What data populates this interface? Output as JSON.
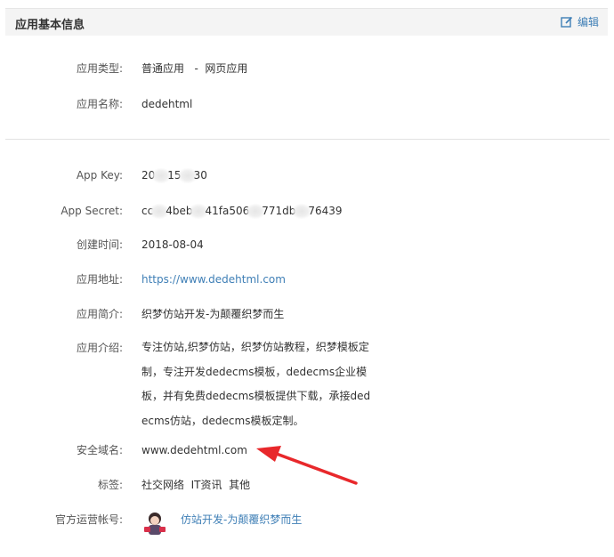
{
  "header": {
    "title": "应用基本信息",
    "edit_label": "编辑"
  },
  "fields": {
    "type": {
      "label": "应用类型:",
      "value": "普通应用   -  网页应用"
    },
    "name": {
      "label": "应用名称:",
      "value": "dedehtml"
    },
    "app_key": {
      "label": "App Key:",
      "parts": [
        "20",
        "15",
        "30"
      ]
    },
    "app_secret": {
      "label": "App Secret:",
      "parts": [
        "cc",
        "4beb",
        "41fa506",
        "771db",
        "76439"
      ]
    },
    "created": {
      "label": "创建时间:",
      "value": "2018-08-04"
    },
    "address": {
      "label": "应用地址:",
      "value": "https://www.dedehtml.com"
    },
    "brief": {
      "label": "应用简介:",
      "value": "织梦仿站开发-为颠覆织梦而生"
    },
    "intro": {
      "label": "应用介绍:",
      "value": "专注仿站,织梦仿站，织梦仿站教程，织梦模板定制，专注开发dedecms模板，dedecms企业模板，并有免费dedecms模板提供下载，承接dedecms仿站，dedecms模板定制。"
    },
    "domain": {
      "label": "安全域名:",
      "value": "www.dedehtml.com"
    },
    "tags": {
      "label": "标签:",
      "value": "社交网络  IT资讯  其他"
    },
    "official": {
      "label": "官方运营帐号:",
      "value": "仿站开发-为颠覆织梦而生"
    }
  },
  "colors": {
    "link": "#3f7fb6",
    "arrow": "#e8282b",
    "header_bg": "#f4f4f4"
  }
}
